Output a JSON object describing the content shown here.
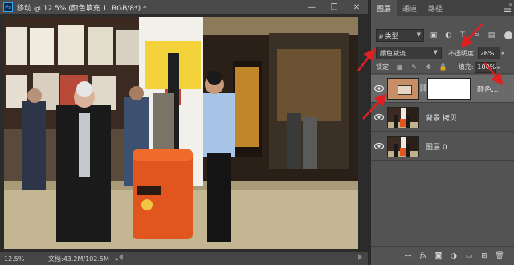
{
  "document": {
    "title": "移动 @ 12.5% (颜色填充 1, RGB/8*) *",
    "app_logo": "Ps",
    "window_controls": [
      "minimize-icon",
      "restore-icon",
      "close-icon"
    ],
    "zoom": "12.5%",
    "doc_info": "文档:43.2M/102.5M",
    "status_arrow": "▸"
  },
  "panel": {
    "tabs": [
      "图层",
      "通道",
      "路径"
    ],
    "active_tab": "图层",
    "filter": {
      "label": "ρ 类型",
      "icons": [
        "image-filter-icon",
        "adjustment-filter-icon",
        "type-filter-icon",
        "shape-filter-icon",
        "smart-object-filter-icon"
      ]
    },
    "blend_mode": "颜色减淡",
    "opacity_label": "不透明度:",
    "opacity_value": "26%",
    "lock_label": "锁定:",
    "fill_label": "填充:",
    "fill_value": "100%",
    "layers": [
      {
        "name": "颜色...",
        "type": "fill",
        "selected": true,
        "swatch_color": "#c88e66"
      },
      {
        "name": "背景 拷贝",
        "type": "image",
        "selected": false
      },
      {
        "name": "图层 0",
        "type": "image",
        "selected": false
      }
    ],
    "bottom_icons": [
      "link-icon",
      "fx-icon",
      "add-mask-icon",
      "adjustment-layer-icon",
      "new-group-icon",
      "new-layer-icon",
      "trash-icon"
    ]
  },
  "colors": {
    "annotation_red": "#e02020",
    "panel_bg": "#535353",
    "selected_row": "#6a6a6a"
  }
}
